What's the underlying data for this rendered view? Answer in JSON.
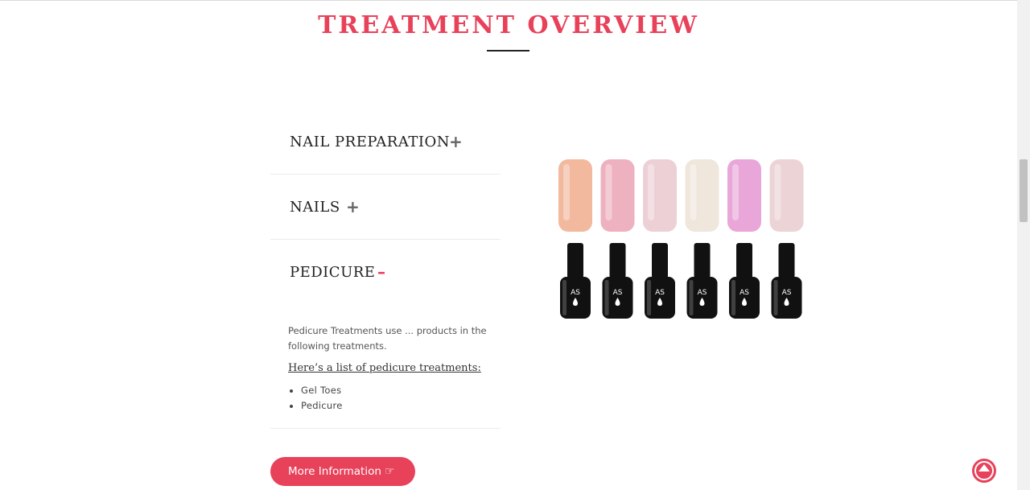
{
  "section": {
    "title": "TREATMENT OVERVIEW"
  },
  "accordion": {
    "items": [
      {
        "label": "NAIL PREPARATION",
        "toggle": "+"
      },
      {
        "label": "NAILS",
        "toggle": "+"
      },
      {
        "label": "PEDICURE",
        "toggle": "–"
      }
    ],
    "panel": {
      "description": "Pedicure Treatments use ... products in the following treatments.",
      "list_heading": "Here’s a list of pedicure treatments:",
      "list": [
        "Gel Toes",
        "Pedicure"
      ]
    }
  },
  "button": {
    "label": "More Information",
    "icon": "hand-pointer-icon"
  },
  "product": {
    "brand_label": "AS",
    "swatches": [
      "#f2b99e",
      "#eeb1c0",
      "#ecd0d6",
      "#efe6dc",
      "#e9a6d8",
      "#ecd3d6"
    ]
  },
  "colors": {
    "accent": "#e8415a",
    "heading": "#222222"
  }
}
